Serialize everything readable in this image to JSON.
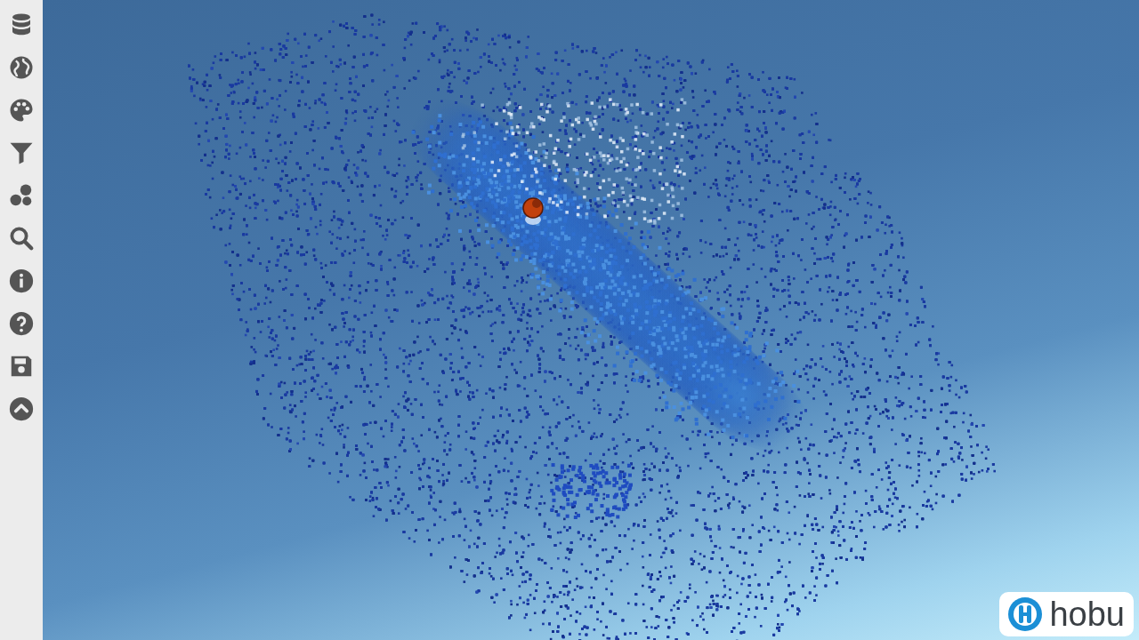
{
  "viewer": {
    "logo": {
      "text": "hobu"
    }
  }
}
